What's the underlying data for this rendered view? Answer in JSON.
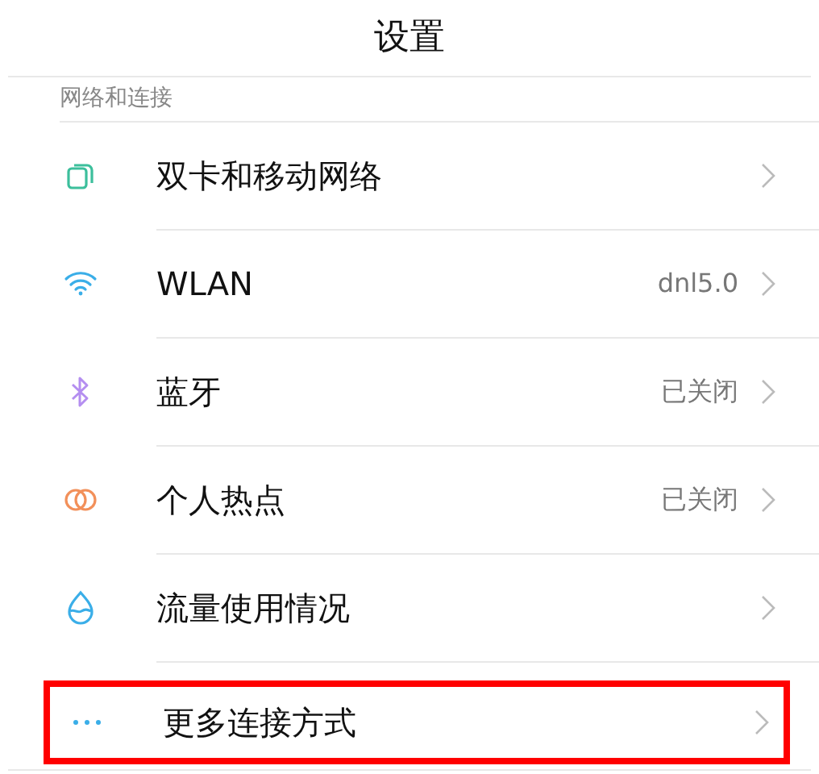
{
  "title": "设置",
  "section": {
    "title": "网络和连接"
  },
  "items": [
    {
      "kind": "sim",
      "label": "双卡和移动网络",
      "highlighted": false
    },
    {
      "kind": "wifi",
      "label": "WLAN",
      "value": "dnl5.0",
      "highlighted": false
    },
    {
      "kind": "bluetooth",
      "label": "蓝牙",
      "value": "已关闭",
      "highlighted": false
    },
    {
      "kind": "hotspot",
      "label": "个人热点",
      "value": "已关闭",
      "highlighted": false
    },
    {
      "kind": "data",
      "label": "流量使用情况",
      "highlighted": false
    },
    {
      "kind": "more",
      "label": "更多连接方式",
      "highlighted": true
    }
  ]
}
